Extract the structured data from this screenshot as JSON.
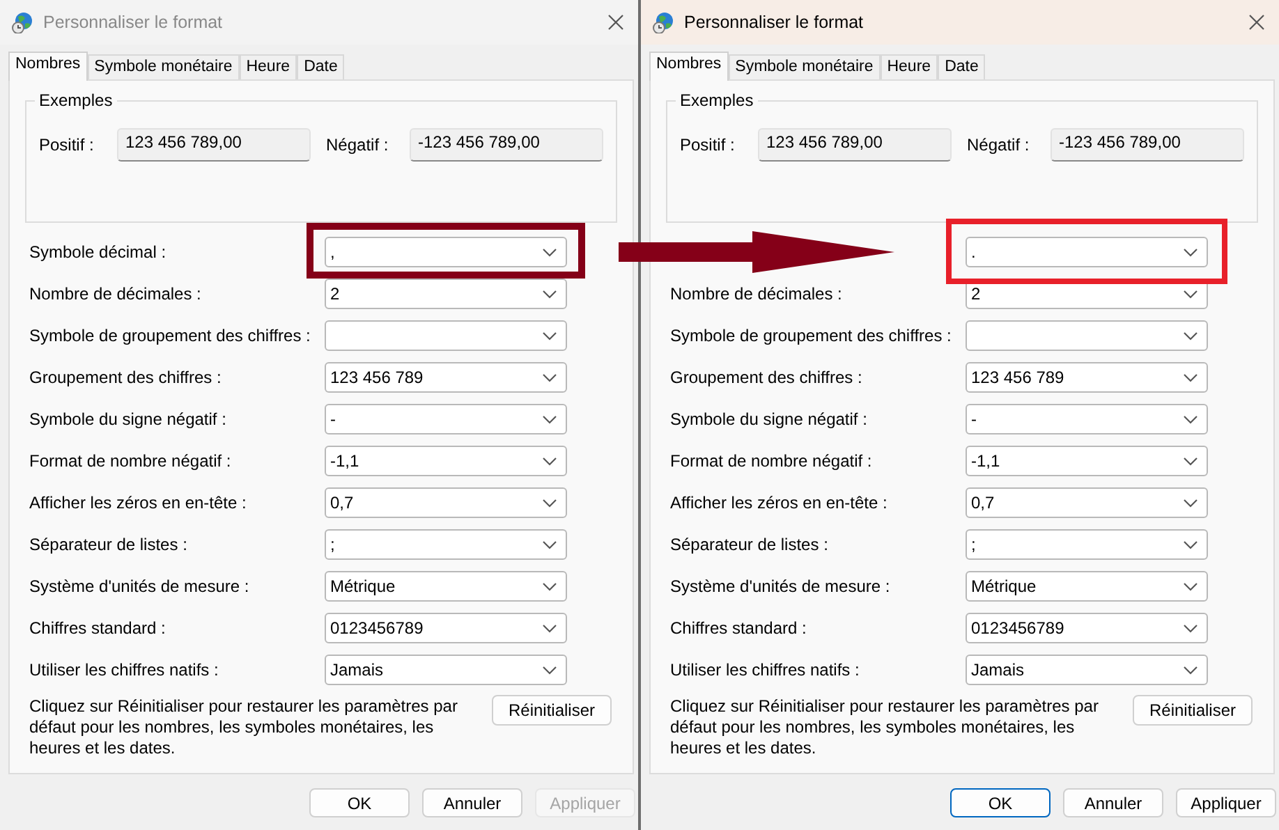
{
  "dialogs": [
    {
      "title": "Personnaliser le format",
      "active": false,
      "tabs": [
        {
          "label": "Nombres",
          "selected": true
        },
        {
          "label": "Symbole monétaire",
          "selected": false
        },
        {
          "label": "Heure",
          "selected": false
        },
        {
          "label": "Date",
          "selected": false
        }
      ],
      "examples": {
        "legend": "Exemples",
        "positive_label": "Positif :",
        "positive_value": "123 456 789,00",
        "negative_label": "Négatif :",
        "negative_value": "-123 456 789,00"
      },
      "rows": [
        {
          "label": "Symbole décimal :",
          "value": ","
        },
        {
          "label": "Nombre de décimales :",
          "value": "2"
        },
        {
          "label": "Symbole de groupement des chiffres :"
        },
        {
          "label": "Groupement des chiffres :",
          "value": "123 456 789"
        },
        {
          "label": "Symbole du signe négatif :",
          "value": "-"
        },
        {
          "label": "Format de nombre négatif :",
          "value": "-1,1"
        },
        {
          "label": "Afficher les zéros en en-tête :",
          "value": "0,7"
        },
        {
          "label": "Séparateur de listes :",
          "value": ";"
        },
        {
          "label": "Système d'unités de mesure :",
          "value": "Métrique"
        },
        {
          "label": "Chiffres standard :",
          "value": "0123456789"
        },
        {
          "label": "Utiliser les chiffres natifs :",
          "value": "Jamais"
        }
      ],
      "note": "Cliquez sur Réinitialiser pour restaurer les paramètres par défaut pour les nombres, les symboles monétaires, les heures et les dates.",
      "reset_button": "Réinitialiser",
      "buttons": [
        {
          "label": "OK",
          "default": false,
          "disabled": false
        },
        {
          "label": "Annuler",
          "default": false,
          "disabled": false
        },
        {
          "label": "Appliquer",
          "default": false,
          "disabled": true
        }
      ]
    },
    {
      "title": "Personnaliser le format",
      "active": true,
      "tabs": [
        {
          "label": "Nombres",
          "selected": true
        },
        {
          "label": "Symbole monétaire",
          "selected": false
        },
        {
          "label": "Heure",
          "selected": false
        },
        {
          "label": "Date",
          "selected": false
        }
      ],
      "examples": {
        "legend": "Exemples",
        "positive_label": "Positif :",
        "positive_value": "123 456 789,00",
        "negative_label": "Négatif :",
        "negative_value": "-123 456 789,00"
      },
      "rows": [
        {
          "value": "."
        },
        {
          "label": "Nombre de décimales :",
          "value": "2"
        },
        {
          "label": "Symbole de groupement des chiffres :"
        },
        {
          "label": "Groupement des chiffres :",
          "value": "123 456 789"
        },
        {
          "label": "Symbole du signe négatif :",
          "value": "-"
        },
        {
          "label": "Format de nombre négatif :",
          "value": "-1,1"
        },
        {
          "label": "Afficher les zéros en en-tête :",
          "value": "0,7"
        },
        {
          "label": "Séparateur de listes :",
          "value": ";"
        },
        {
          "label": "Système d'unités de mesure :",
          "value": "Métrique"
        },
        {
          "label": "Chiffres standard :",
          "value": "0123456789"
        },
        {
          "label": "Utiliser les chiffres natifs :",
          "value": "Jamais"
        }
      ],
      "note": "Cliquez sur Réinitialiser pour restaurer les paramètres par défaut pour les nombres, les symboles monétaires, les heures et les dates.",
      "reset_button": "Réinitialiser",
      "buttons": [
        {
          "label": "OK",
          "default": true,
          "disabled": false
        },
        {
          "label": "Annuler",
          "default": false,
          "disabled": false
        },
        {
          "label": "Appliquer",
          "default": false,
          "disabled": false
        }
      ]
    }
  ],
  "annotations": [
    {
      "kind": "box",
      "color": "#850018"
    },
    {
      "kind": "arrow",
      "color": "#850018"
    },
    {
      "kind": "box",
      "color": "#e8202a"
    }
  ]
}
